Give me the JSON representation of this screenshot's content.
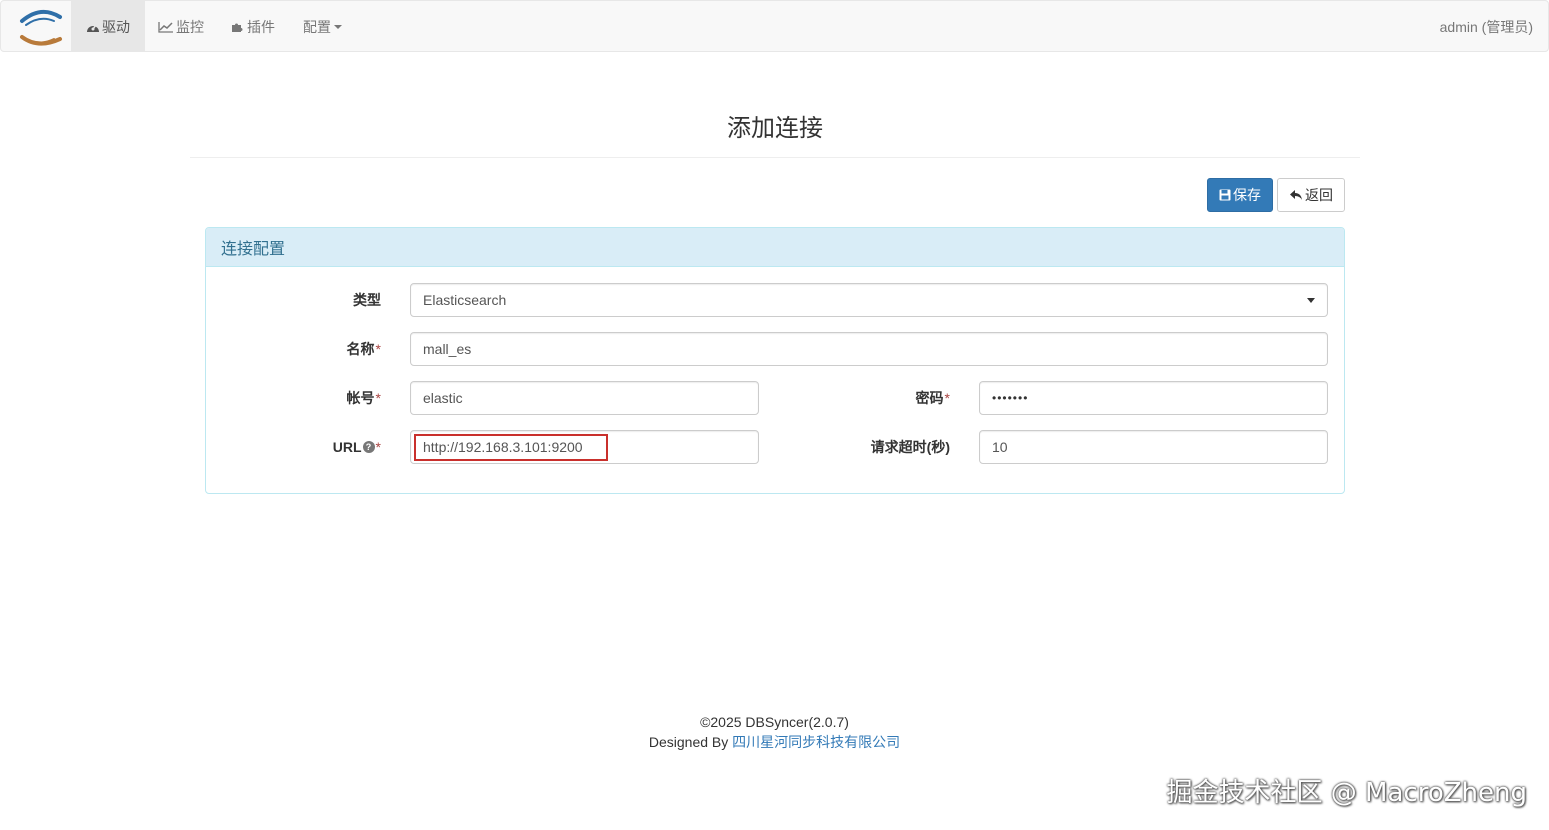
{
  "nav": {
    "brand": "dbsyncer",
    "items": [
      {
        "label": "驱动",
        "icon": "dashboard-icon",
        "active": true
      },
      {
        "label": "监控",
        "icon": "line-chart-icon",
        "active": false
      },
      {
        "label": "插件",
        "icon": "puzzle-icon",
        "active": false
      },
      {
        "label": "配置",
        "icon": "",
        "active": false,
        "dropdown": true
      }
    ],
    "user": "admin (管理员)"
  },
  "page": {
    "title": "添加连接"
  },
  "toolbar": {
    "save_label": "保存",
    "back_label": "返回"
  },
  "panel": {
    "heading": "连接配置",
    "fields": {
      "type": {
        "label": "类型",
        "value": "Elasticsearch"
      },
      "name": {
        "label": "名称",
        "required": "*",
        "value": "mall_es"
      },
      "account": {
        "label": "帐号",
        "required": "*",
        "value": "elastic"
      },
      "password": {
        "label": "密码",
        "required": "*",
        "value": "•••••••"
      },
      "url": {
        "label": "URL",
        "help": "?",
        "required": "*",
        "value": "http://192.168.3.101:9200"
      },
      "timeout": {
        "label": "请求超时(秒)",
        "value": "10"
      }
    }
  },
  "footer": {
    "copyright": "©2025 DBSyncer(2.0.7)",
    "designed_by": "Designed By ",
    "company": "四川星河同步科技有限公司"
  },
  "watermark": "掘金技术社区 @ MacroZheng",
  "colors": {
    "primary": "#337ab7",
    "panel_heading_bg": "#d9edf7",
    "panel_heading_text": "#31708f",
    "required": "#a94442",
    "highlight": "#c9302c"
  }
}
